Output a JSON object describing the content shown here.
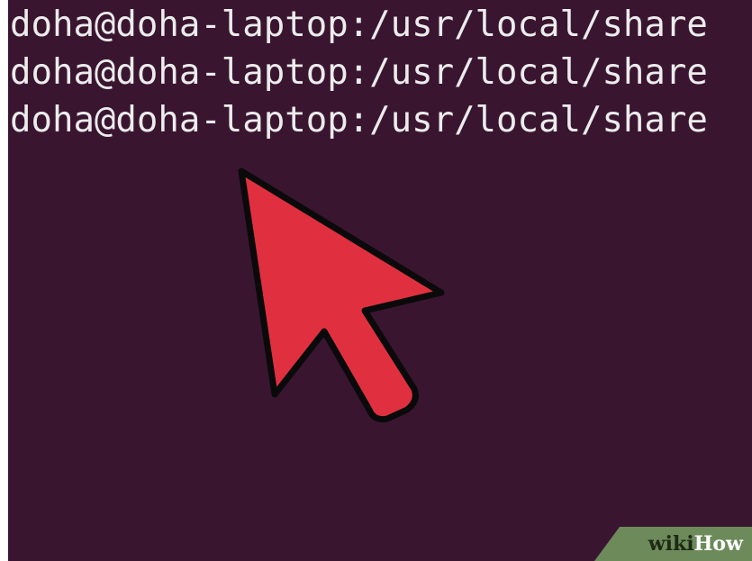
{
  "terminal": {
    "lines": [
      "doha@doha-laptop:/usr/local/share",
      "doha@doha-laptop:/usr/local/share",
      "doha@doha-laptop:/usr/local/share"
    ]
  },
  "cursor": {
    "icon": "mouse-pointer-arrow-icon",
    "color": "#e03040"
  },
  "watermark": {
    "wiki": "wiki",
    "how": "How"
  },
  "colors": {
    "terminal_background": "#3a1530",
    "terminal_text": "#ececec",
    "watermark_background": "#6d8a5b"
  }
}
